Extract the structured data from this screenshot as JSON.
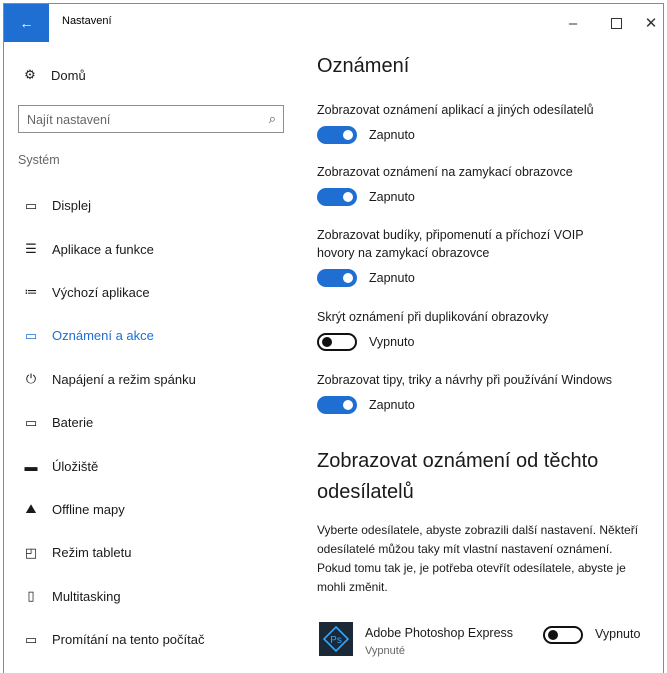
{
  "window": {
    "title": "Nastavení",
    "back_icon": "arrow-left-icon",
    "minimize_glyph": "–",
    "close_glyph": "✕"
  },
  "sidebar": {
    "home_label": "Domů",
    "search_placeholder": "Najít nastavení",
    "section_label": "Systém",
    "items": [
      {
        "label": "Displej",
        "icon": "monitor-icon",
        "glyph": "▭"
      },
      {
        "label": "Aplikace a funkce",
        "icon": "list-icon",
        "glyph": "☰"
      },
      {
        "label": "Výchozí aplikace",
        "icon": "default-apps-icon",
        "glyph": "≔"
      },
      {
        "label": "Oznámení a akce",
        "icon": "message-icon",
        "glyph": "▭",
        "active": true
      },
      {
        "label": "Napájení a režim spánku",
        "icon": "power-icon",
        "glyph": "⏻"
      },
      {
        "label": "Baterie",
        "icon": "battery-icon",
        "glyph": "▭"
      },
      {
        "label": "Úložiště",
        "icon": "storage-icon",
        "glyph": "▬"
      },
      {
        "label": "Offline mapy",
        "icon": "map-icon",
        "glyph": "⛰"
      },
      {
        "label": "Režim tabletu",
        "icon": "tablet-icon",
        "glyph": "◰"
      },
      {
        "label": "Multitasking",
        "icon": "multitasking-icon",
        "glyph": "▯"
      },
      {
        "label": "Promítání na tento počítač",
        "icon": "project-icon",
        "glyph": "▭"
      }
    ]
  },
  "main": {
    "title": "Oznámení",
    "settings": [
      {
        "label": "Zobrazovat oznámení aplikací a jiných odesílatelů",
        "state": "Zapnuto",
        "on": true
      },
      {
        "label": "Zobrazovat oznámení na zamykací obrazovce",
        "state": "Zapnuto",
        "on": true
      },
      {
        "label": "Zobrazovat budíky, připomenutí a příchozí VOIP hovory na zamykací obrazovce",
        "state": "Zapnuto",
        "on": true
      },
      {
        "label": "Skrýt oznámení při duplikování obrazovky",
        "state": "Vypnuto",
        "on": false
      },
      {
        "label": "Zobrazovat tipy, triky a návrhy při používání Windows",
        "state": "Zapnuto",
        "on": true
      }
    ],
    "senders_title": "Zobrazovat oznámení od těchto odesílatelů",
    "senders_desc": "Vyberte odesílatele, abyste zobrazili další nastavení. Někteří odesílatelé můžou taky mít vlastní nastavení oznámení. Pokud tomu tak je, je potřeba otevřít odesílatele, abyste je mohli změnit.",
    "senders": [
      {
        "name": "Adobe Photoshop Express",
        "sub": "Vypnuté",
        "state": "Vypnuto",
        "on": false,
        "icon_text": "Ps"
      }
    ]
  },
  "colors": {
    "accent": "#1e6fd1",
    "app_icon_bg": "#1b2836"
  }
}
